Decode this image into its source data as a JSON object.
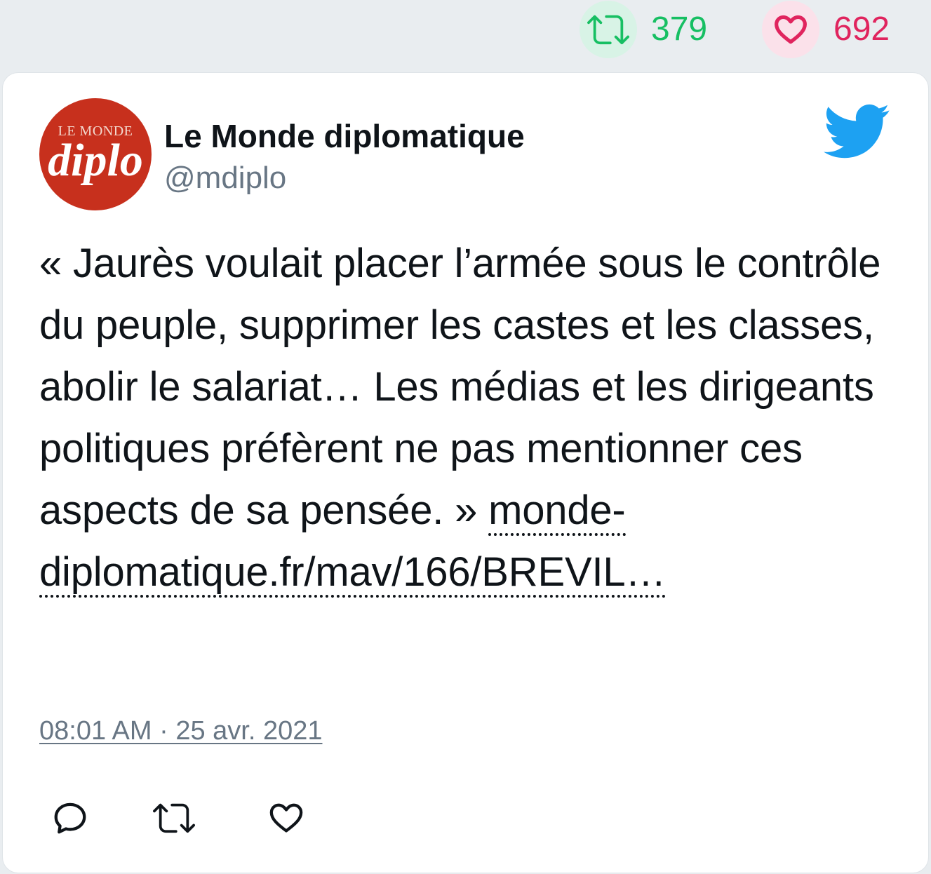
{
  "stats": {
    "retweet_count": "379",
    "like_count": "692"
  },
  "colors": {
    "retweet": "#17bf63",
    "like": "#e0245e",
    "twitter_blue": "#1da1f2",
    "avatar_bg": "#c7301d"
  },
  "author": {
    "avatar_top_text": "LE MONDE",
    "avatar_main_text": "diplo",
    "name": "Le Monde diplomatique",
    "handle": "@mdiplo"
  },
  "tweet": {
    "text": "« Jaurès voulait placer l’armée sous le contrôle du peuple, supprimer les castes et les classes, abolir le salariat… Les médias et les dirigeants politiques préfèrent ne pas mentionner ces aspects de sa pensée. » ",
    "link_text": "monde-diplomatique.fr/mav/166/BREVIL…",
    "timestamp": "08:01 AM · 25 avr. 2021"
  },
  "icons": {
    "retweet": "retweet-icon",
    "like": "heart-icon",
    "bird": "twitter-bird-icon",
    "reply": "reply-icon"
  }
}
